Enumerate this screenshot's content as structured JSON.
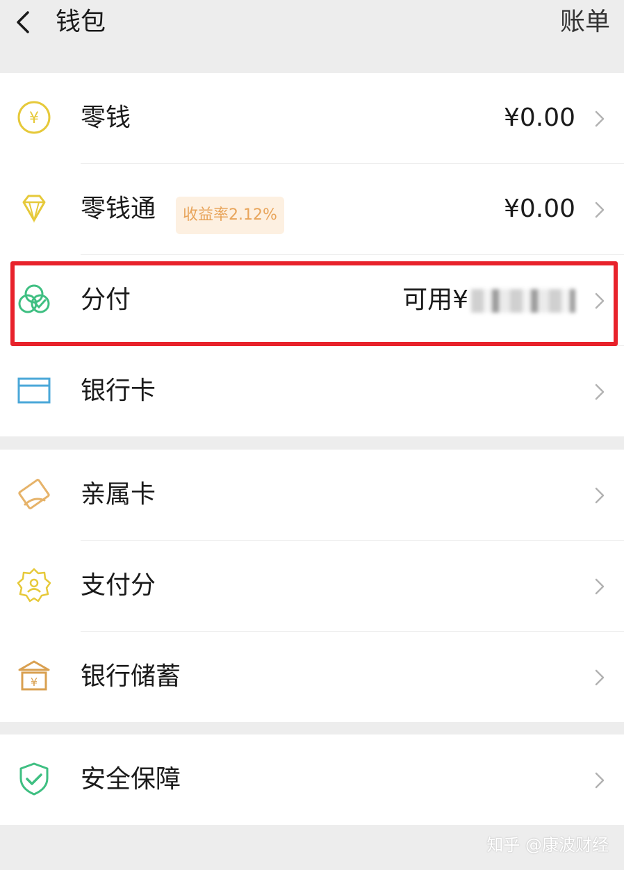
{
  "header": {
    "title": "钱包",
    "bill_label": "账单"
  },
  "rows": [
    {
      "label": "零钱",
      "value": "¥0.00"
    },
    {
      "label": "零钱通",
      "badge": "收益率2.12%",
      "value": "¥0.00"
    },
    {
      "label": "分付",
      "value_prefix": "可用¥"
    },
    {
      "label": "银行卡"
    },
    {
      "label": "亲属卡"
    },
    {
      "label": "支付分"
    },
    {
      "label": "银行储蓄"
    },
    {
      "label": "安全保障"
    }
  ],
  "colors": {
    "highlight_border": "#e8222b",
    "badge_bg": "#fdf0e1",
    "badge_text": "#e8a45a",
    "coin_icon": "#e6c93a",
    "diamond_icon": "#e6c93a",
    "fenfu_icon": "#3fbf82",
    "bank_card_icon": "#4aa7d8",
    "family_card_icon": "#e6b36a",
    "pay_score_icon": "#e6c93a",
    "bank_savings_icon": "#d9a050",
    "security_icon": "#3fbf82"
  },
  "icons": [
    "back-chevron",
    "yuan-coin",
    "diamond",
    "fenfu-circles",
    "bank-card",
    "family-card",
    "pay-score",
    "bank-building",
    "shield-check",
    "chevron-right"
  ],
  "watermark": "知乎 @康波财经"
}
